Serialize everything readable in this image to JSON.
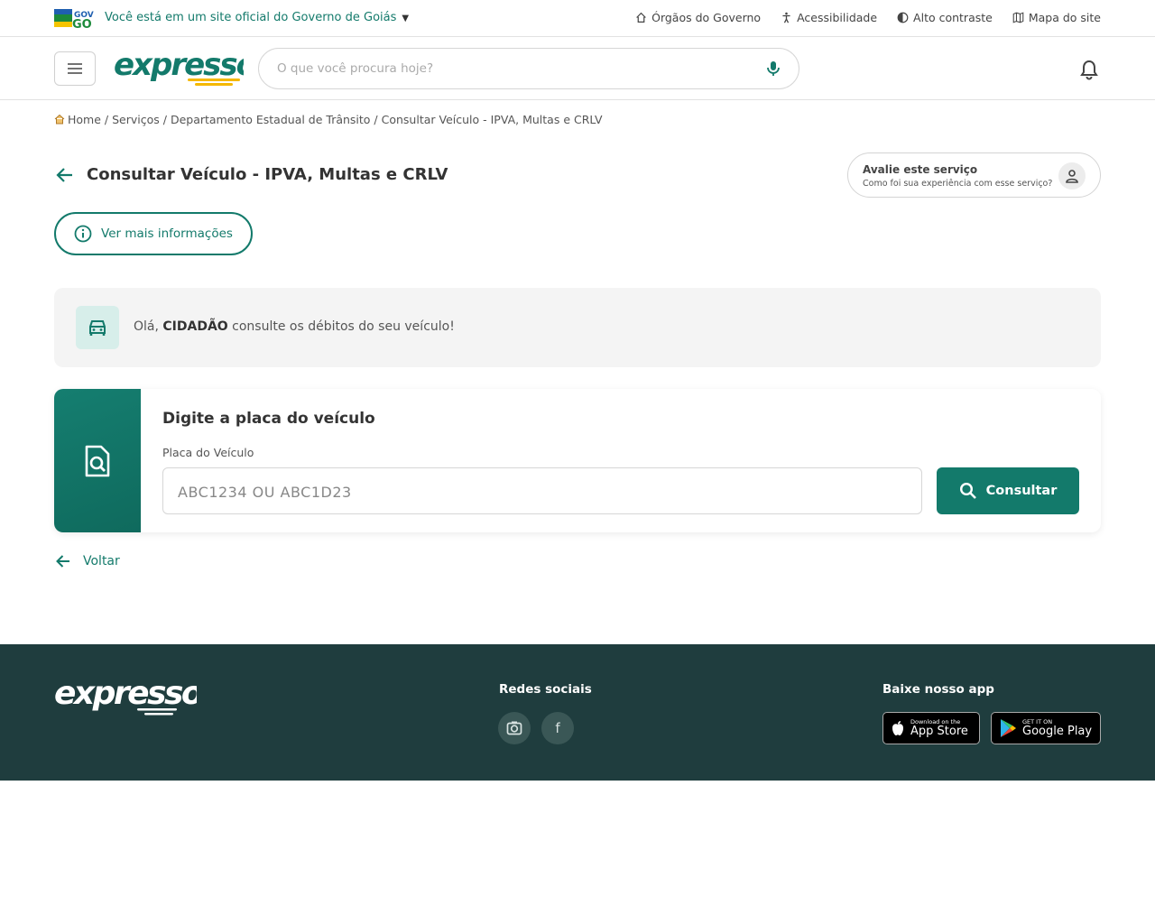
{
  "gov_bar": {
    "logo_alt": "GOV GO",
    "official_text": "Você está em um site oficial do Governo de Goiás",
    "links": [
      {
        "label": "Órgãos do Governo",
        "icon": "home-icon"
      },
      {
        "label": "Acessibilidade",
        "icon": "accessibility-icon"
      },
      {
        "label": "Alto contraste",
        "icon": "contrast-icon"
      },
      {
        "label": "Mapa do site",
        "icon": "map-icon"
      }
    ]
  },
  "header": {
    "brand": "expresso",
    "search_placeholder": "O que você procura hoje?"
  },
  "breadcrumb": {
    "items": [
      "Home",
      "Serviços",
      "Departamento Estadual de Trânsito",
      "Consultar Veículo - IPVA, Multas e CRLV"
    ],
    "separator": " / "
  },
  "page": {
    "title": "Consultar Veículo - IPVA, Multas e CRLV",
    "rate_title": "Avalie este serviço",
    "rate_subtitle": "Como foi sua experiência com esse serviço?",
    "more_info": "Ver mais informações"
  },
  "greeting": {
    "prefix": "Olá, ",
    "name": "CIDADÃO",
    "suffix": " consulte os débitos do seu veículo!"
  },
  "plate_form": {
    "heading": "Digite a placa do veículo",
    "label": "Placa do Veículo",
    "placeholder": "ABC1234 OU ABC1D23",
    "value": "",
    "button": "Consultar"
  },
  "back_label": "Voltar",
  "footer": {
    "brand": "expresso",
    "social_title": "Redes sociais",
    "social_icons": [
      "instagram-icon",
      "facebook-icon"
    ],
    "facebook_glyph": "f",
    "app_title": "Baixe nosso app",
    "app_store": {
      "small": "Download on the",
      "big": "App Store"
    },
    "google_play": {
      "small": "GET IT ON",
      "big": "Google Play"
    }
  },
  "colors": {
    "primary": "#137a6b",
    "footer_bg": "#1f3d3e",
    "brand_yellow": "#f5b800"
  }
}
